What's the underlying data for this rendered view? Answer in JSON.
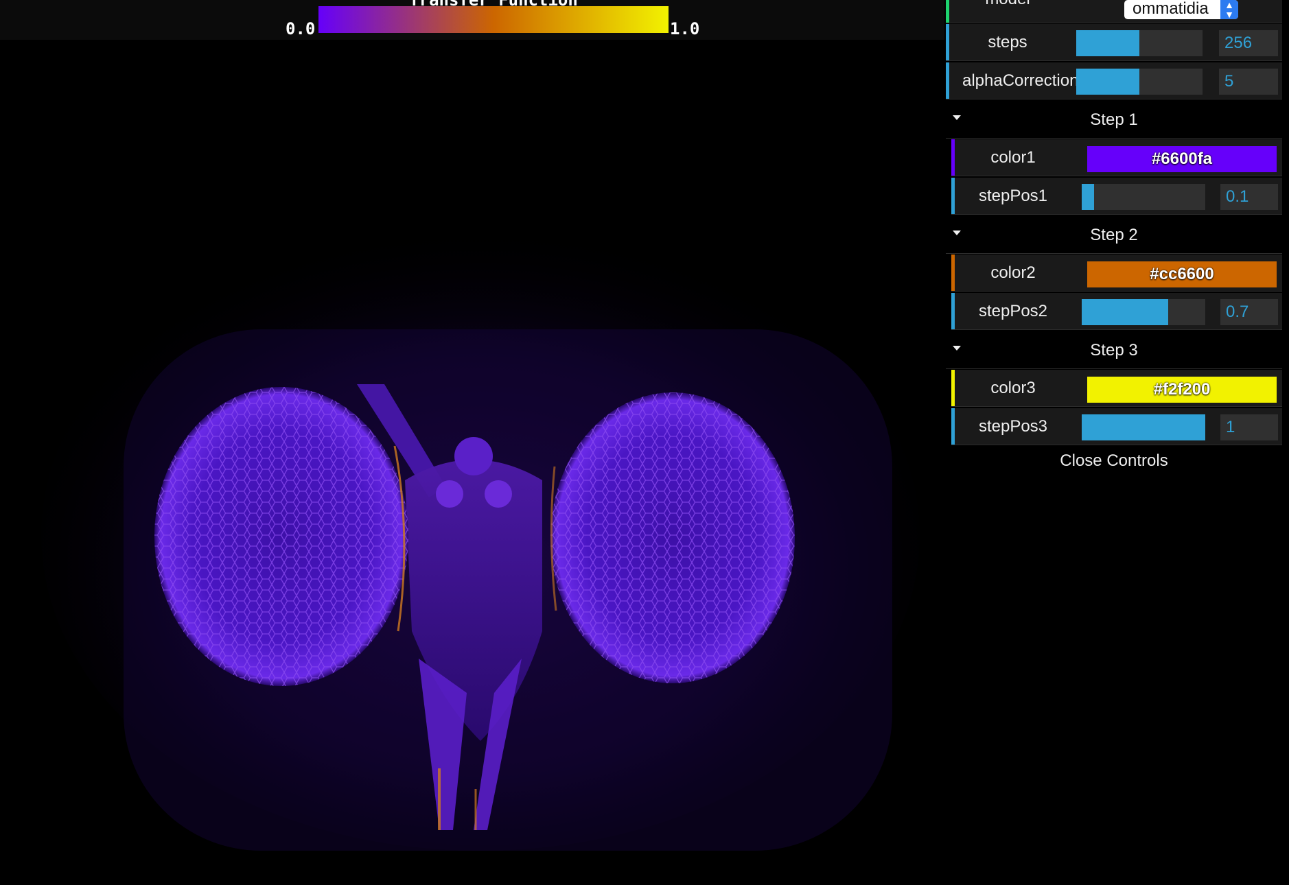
{
  "transfer_function": {
    "title": "Transfer Function",
    "min_label": "0.0",
    "max_label": "1.0",
    "gradient": [
      "#6600fa",
      "#cc6600",
      "#f2f200"
    ]
  },
  "gui": {
    "model": {
      "label": "model",
      "value": "ommatidia",
      "accent": "#1ed36f"
    },
    "steps": {
      "label": "steps",
      "value": "256",
      "fill": 0.5
    },
    "alphaCorrection": {
      "label": "alphaCorrection",
      "value": "5",
      "fill": 0.5
    },
    "folders": [
      {
        "title": "Step 1",
        "color_label": "color1",
        "color_value": "#6600fa",
        "color": "#6600fa",
        "pos_label": "stepPos1",
        "pos_value": "0.1",
        "pos_fill": 0.1
      },
      {
        "title": "Step 2",
        "color_label": "color2",
        "color_value": "#cc6600",
        "color": "#cc6600",
        "pos_label": "stepPos2",
        "pos_value": "0.7",
        "pos_fill": 0.7
      },
      {
        "title": "Step 3",
        "color_label": "color3",
        "color_value": "#f2f200",
        "color": "#f2f200",
        "pos_label": "stepPos3",
        "pos_value": "1",
        "pos_fill": 1.0
      }
    ],
    "close_label": "Close Controls",
    "accent_color": "#2fa1d6"
  }
}
